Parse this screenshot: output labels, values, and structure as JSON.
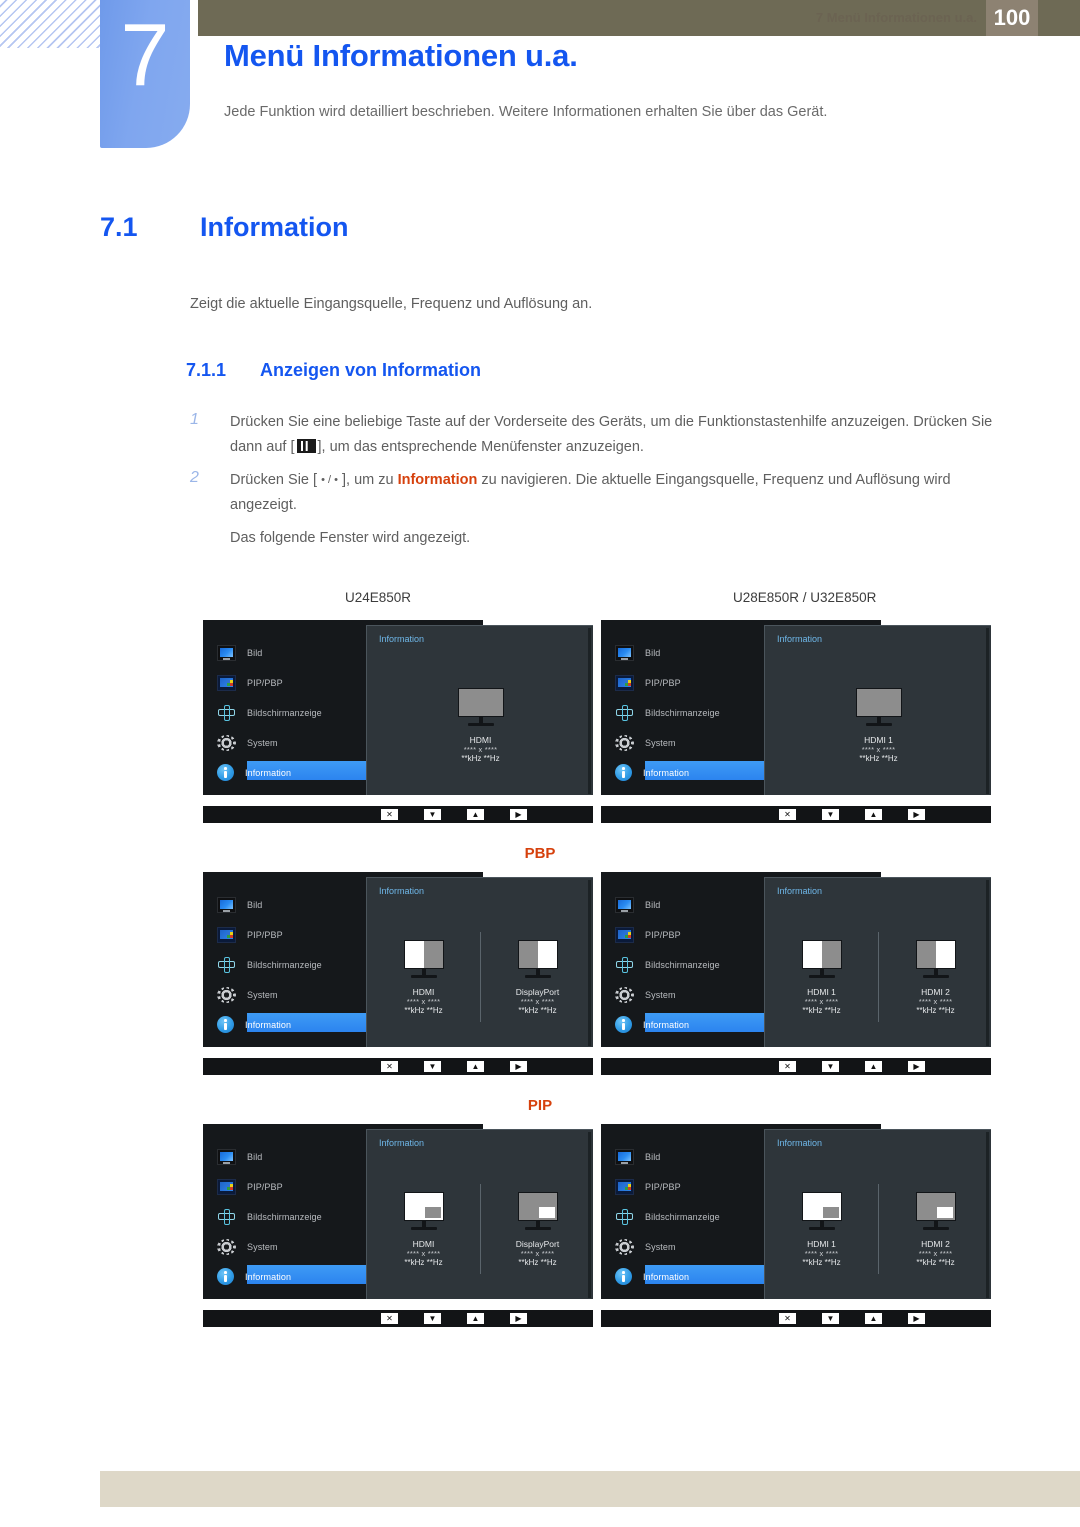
{
  "header": {
    "chapter_number": "7",
    "chapter_title": "Menü Informationen u.a.",
    "chapter_desc": "Jede Funktion wird detailliert beschrieben. Weitere Informationen erhalten Sie über das Gerät."
  },
  "section": {
    "number": "7.1",
    "title": "Information",
    "intro": "Zeigt die aktuelle Eingangsquelle, Frequenz und Auflösung an.",
    "sub_number": "7.1.1",
    "sub_title": "Anzeigen von Information"
  },
  "steps": [
    {
      "n": "1",
      "part_a": "Drücken Sie eine beliebige Taste auf der Vorderseite des Geräts, um die Funktionstastenhilfe anzuzeigen. Drücken Sie dann auf [",
      "part_b": "], um das entsprechende Menüfenster anzuzeigen."
    },
    {
      "n": "2",
      "part_a": "Drücken Sie [ ",
      "dots": "• / •",
      "part_b": " ], um zu ",
      "keyword": "Information",
      "part_c": " zu navigieren. Die aktuelle Eingangsquelle, Frequenz und Auflösung wird angezeigt."
    }
  ],
  "note": "Das folgende Fenster wird angezeigt.",
  "models": {
    "left": "U24E850R",
    "right": "U28E850R / U32E850R"
  },
  "group_labels": {
    "pbp": "PBP",
    "pip": "PIP"
  },
  "osd": {
    "nav_items": [
      {
        "label": "Bild",
        "icon": "monitor-icon",
        "selected": false
      },
      {
        "label": "PIP/PBP",
        "icon": "pip-pbp-icon",
        "selected": false
      },
      {
        "label": "Bildschirmanzeige",
        "icon": "move-cross-icon",
        "selected": false
      },
      {
        "label": "System",
        "icon": "gear-icon",
        "selected": false
      },
      {
        "label": "Information",
        "icon": "info-circle-icon",
        "selected": true
      }
    ],
    "pane_title": "Information",
    "keys": [
      {
        "glyph": "✕",
        "name": "close-key"
      },
      {
        "glyph": "▼",
        "name": "down-key"
      },
      {
        "glyph": "▲",
        "name": "up-key"
      },
      {
        "glyph": "▶",
        "name": "right-key"
      }
    ],
    "panels": {
      "single_left": {
        "monitors": [
          {
            "source": "HDMI",
            "res": "**** x ****",
            "freq": "**kHz **Hz",
            "mode": "full"
          }
        ]
      },
      "single_right": {
        "monitors": [
          {
            "source": "HDMI 1",
            "res": "**** x ****",
            "freq": "**kHz **Hz",
            "mode": "full"
          }
        ]
      },
      "pbp_left": {
        "monitors": [
          {
            "source": "HDMI",
            "res": "**** x ****",
            "freq": "**kHz **Hz",
            "mode": "split-left"
          },
          {
            "source": "DisplayPort",
            "res": "**** x ****",
            "freq": "**kHz **Hz",
            "mode": "split-right"
          }
        ]
      },
      "pbp_right": {
        "monitors": [
          {
            "source": "HDMI 1",
            "res": "**** x ****",
            "freq": "**kHz **Hz",
            "mode": "split-left"
          },
          {
            "source": "HDMI 2",
            "res": "**** x ****",
            "freq": "**kHz **Hz",
            "mode": "split-right"
          }
        ]
      },
      "pip_left": {
        "monitors": [
          {
            "source": "HDMI",
            "res": "**** x ****",
            "freq": "**kHz **Hz",
            "mode": "pip-white"
          },
          {
            "source": "DisplayPort",
            "res": "**** x ****",
            "freq": "**kHz **Hz",
            "mode": "pip-gray"
          }
        ]
      },
      "pip_right": {
        "monitors": [
          {
            "source": "HDMI 1",
            "res": "**** x ****",
            "freq": "**kHz **Hz",
            "mode": "pip-white"
          },
          {
            "source": "HDMI 2",
            "res": "**** x ****",
            "freq": "**kHz **Hz",
            "mode": "pip-gray"
          }
        ]
      }
    }
  },
  "footer": {
    "text": "7 Menü Informationen u.a.",
    "page": "100"
  },
  "colors": {
    "accent_blue": "#1456f0",
    "keyword_orange": "#d6410d",
    "topbar_olive": "#6e6a55",
    "footer_beige": "#ded8c8",
    "page_box": "#8d8272",
    "osd_nav_bg": "#15181b",
    "osd_pane_bg": "#2e353a",
    "osd_highlight": "#2c84ef"
  }
}
